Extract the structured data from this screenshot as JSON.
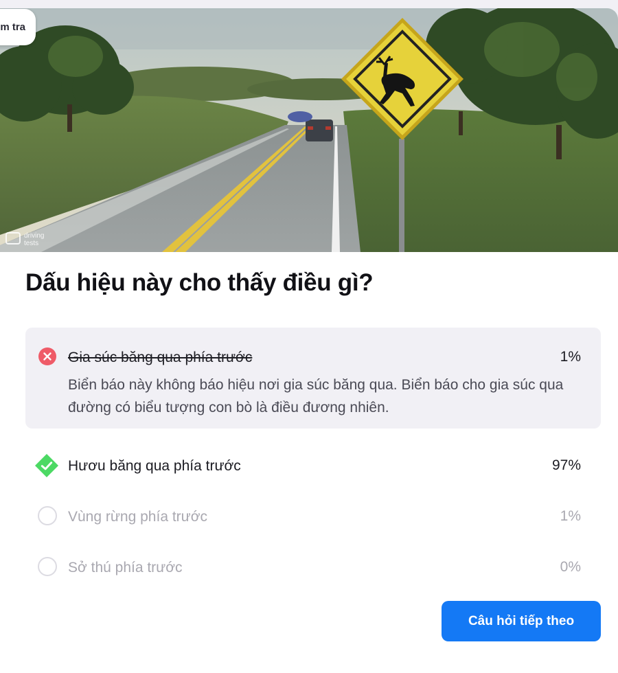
{
  "top_tag": {
    "label": "m tra"
  },
  "image": {
    "watermark": [
      "driving",
      "tests"
    ]
  },
  "question": "Dấu hiệu này cho thấy điều gì?",
  "options": [
    {
      "label": "Gia súc băng qua phía trước",
      "percent": "1%",
      "state": "wrong",
      "explanation": "Biển báo này không báo hiệu nơi gia súc băng qua. Biển báo cho gia súc qua đường có biểu tượng con bò là điều đương nhiên."
    },
    {
      "label": "Hươu băng qua phía trước",
      "percent": "97%",
      "state": "correct"
    },
    {
      "label": "Vùng rừng phía trước",
      "percent": "1%",
      "state": "unselected"
    },
    {
      "label": "Sở thú phía trước",
      "percent": "0%",
      "state": "unselected"
    }
  ],
  "next_button": {
    "label": "Câu hỏi tiếp theo"
  },
  "colors": {
    "accent": "#1479f5",
    "wrong": "#ef5b68",
    "correct": "#4cd964",
    "muted": "#a9a8b0"
  },
  "icons": {
    "wrong": "close-icon",
    "correct": "check-icon"
  }
}
